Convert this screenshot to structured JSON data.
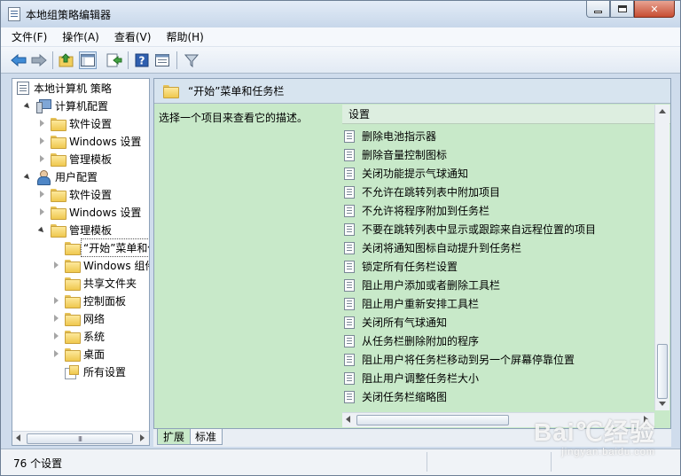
{
  "window": {
    "title": "本地组策略编辑器",
    "buttons": {
      "minimize": "minimize-icon",
      "maximize": "maximize-icon",
      "close": "close-icon"
    }
  },
  "menu": [
    "文件(F)",
    "操作(A)",
    "查看(V)",
    "帮助(H)"
  ],
  "toolbar": {
    "icons": [
      "back-icon",
      "forward-icon",
      "up-folder-icon",
      "show-hide-tree-icon",
      "export-list-icon",
      "help-icon",
      "properties-icon",
      "filter-icon"
    ]
  },
  "tree": {
    "root": "本地计算机 策略",
    "computer_config": "计算机配置",
    "computer_children": [
      "软件设置",
      "Windows 设置",
      "管理模板"
    ],
    "user_config": "用户配置",
    "user_children": [
      "软件设置",
      "Windows 设置",
      "管理模板"
    ],
    "admin_children": [
      "“开始”菜单和任务栏",
      "Windows 组件",
      "共享文件夹",
      "控制面板",
      "网络",
      "系统",
      "桌面",
      "所有设置"
    ]
  },
  "content": {
    "header_title": "“开始”菜单和任务栏",
    "description": "选择一个项目来查看它的描述。",
    "column_header": "设置",
    "settings": [
      "删除电池指示器",
      "删除音量控制图标",
      "关闭功能提示气球通知",
      "不允许在跳转列表中附加项目",
      "不允许将程序附加到任务栏",
      "不要在跳转列表中显示或跟踪来自远程位置的项目",
      "关闭将通知图标自动提升到任务栏",
      "锁定所有任务栏设置",
      "阻止用户添加或者删除工具栏",
      "阻止用户重新安排工具栏",
      "关闭所有气球通知",
      "从任务栏删除附加的程序",
      "阻止用户将任务栏移动到另一个屏幕停靠位置",
      "阻止用户调整任务栏大小",
      "关闭任务栏缩略图"
    ]
  },
  "tabs": [
    "扩展",
    "标准"
  ],
  "status": {
    "text": "76 个设置"
  },
  "scrollbar": {
    "thumb_glyph": "III"
  },
  "watermark": {
    "logo": "Bai℃经验",
    "sub": "jingyan.baidu.com"
  }
}
